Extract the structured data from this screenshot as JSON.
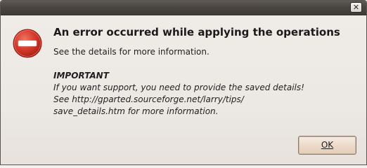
{
  "window": {
    "close_glyph": "✕"
  },
  "dialog": {
    "icon": "stop-icon",
    "title": "An error occurred while applying the operations",
    "subtitle": "See the details for more information.",
    "important_heading": "IMPORTANT",
    "important_lines": [
      "If you want support, you need to provide the saved details!",
      "See http://gparted.sourceforge.net/larry/tips/",
      "save_details.htm for more information."
    ]
  },
  "buttons": {
    "ok_label": "OK"
  },
  "colors": {
    "stop_red": "#d23a2a",
    "button_face": "#ecd9c8",
    "titlebar": "#4a4642"
  }
}
